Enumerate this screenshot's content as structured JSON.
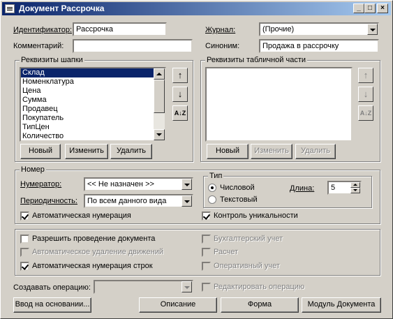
{
  "window": {
    "title": "Документ Рассрочка",
    "min": "_",
    "max": "□",
    "close": "×"
  },
  "header": {
    "id_label": "Идентификатор:",
    "id_value": "Рассрочка",
    "comment_label": "Комментарий:",
    "comment_value": "",
    "journal_label": "Журнал:",
    "journal_value": "(Прочие)",
    "synonym_label": "Синоним:",
    "synonym_value": "Продажа в рассрочку"
  },
  "head_attrs": {
    "title": "Реквизиты шапки",
    "items": [
      "Склад",
      "Номенклатура",
      "Цена",
      "Сумма",
      "Продавец",
      "Покупатель",
      "ТипЦен",
      "Количество"
    ],
    "btn_new": "Новый",
    "btn_edit": "Изменить",
    "btn_delete": "Удалить"
  },
  "table_attrs": {
    "title": "Реквизиты табличной части",
    "btn_new": "Новый",
    "btn_edit": "Изменить",
    "btn_delete": "Удалить"
  },
  "icons": {
    "up": "↑",
    "down": "↓",
    "sort": "A↓Z"
  },
  "number": {
    "title": "Номер",
    "numerator_label": "Нумератор:",
    "numerator_value": "<< Не назначен >>",
    "period_label": "Периодичность:",
    "period_value": "По всем данного вида",
    "type_title": "Тип",
    "numeric": "Числовой",
    "text": "Текстовый",
    "length_label": "Длина:",
    "length_value": "5",
    "auto_num": "Автоматическая нумерация",
    "unique": "Контроль уникальности"
  },
  "options": {
    "allow_post": "Разрешить проведение документа",
    "auto_delete": "Автоматическое удаление движений",
    "auto_rows": "Автоматическая нумерация строк",
    "accounting": "Бухгалтерский учет",
    "calc": "Расчет",
    "operative": "Оперативный учет"
  },
  "operation": {
    "label": "Создавать операцию:",
    "value": "",
    "edit": "Редактировать операцию"
  },
  "bottom": {
    "based_on": "Ввод на основании...",
    "description": "Описание",
    "form": "Форма",
    "module": "Модуль Документа"
  }
}
